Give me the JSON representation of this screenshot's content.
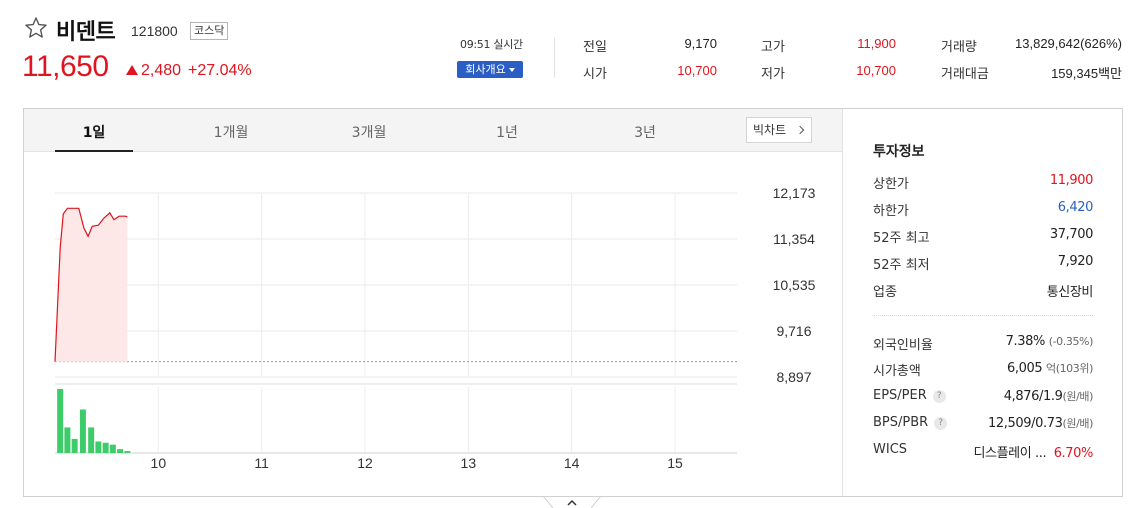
{
  "header": {
    "name": "비덴트",
    "code": "121800",
    "market": "코스닥",
    "price": "11,650",
    "change_abs": "2,480",
    "change_pct": "+27.04%",
    "realtime": "09:51 실시간",
    "company_btn": "회사개요"
  },
  "quote": {
    "prev_close": {
      "label": "전일",
      "value": "9,170"
    },
    "open": {
      "label": "시가",
      "value": "10,700"
    },
    "high": {
      "label": "고가",
      "value": "11,900"
    },
    "low": {
      "label": "저가",
      "value": "10,700"
    },
    "volume": {
      "label": "거래량",
      "value": "13,829,642(626%)"
    },
    "amount": {
      "label": "거래대금",
      "value": "159,345백만"
    }
  },
  "tabs": [
    "1일",
    "1개월",
    "3개월",
    "1년",
    "3년"
  ],
  "bigchart_label": "빅차트",
  "colors": {
    "up": "#e0141e",
    "down": "#2b5ec4",
    "volume_bar": "#3ecb6a",
    "area_fill": "#fde7e7"
  },
  "chart_data": {
    "type": "area",
    "price_axis": [
      "12,173",
      "11,354",
      "10,535",
      "9,716",
      "8,897"
    ],
    "price_ylim": [
      8897,
      12173
    ],
    "time_ticks": [
      "10",
      "11",
      "12",
      "13",
      "14",
      "15"
    ],
    "prev_close": 9170,
    "price_series": [
      {
        "t": 9.0,
        "v": 9170
      },
      {
        "t": 9.05,
        "v": 11200
      },
      {
        "t": 9.08,
        "v": 11800
      },
      {
        "t": 9.12,
        "v": 11900
      },
      {
        "t": 9.18,
        "v": 11900
      },
      {
        "t": 9.23,
        "v": 11900
      },
      {
        "t": 9.28,
        "v": 11550
      },
      {
        "t": 9.32,
        "v": 11400
      },
      {
        "t": 9.36,
        "v": 11580
      },
      {
        "t": 9.42,
        "v": 11600
      },
      {
        "t": 9.47,
        "v": 11720
      },
      {
        "t": 9.53,
        "v": 11820
      },
      {
        "t": 9.57,
        "v": 11700
      },
      {
        "t": 9.62,
        "v": 11760
      },
      {
        "t": 9.68,
        "v": 11760
      },
      {
        "t": 9.7,
        "v": 11750
      }
    ],
    "volume_series": [
      {
        "t": 9.05,
        "v": 1.0
      },
      {
        "t": 9.12,
        "v": 0.4
      },
      {
        "t": 9.19,
        "v": 0.22
      },
      {
        "t": 9.27,
        "v": 0.68
      },
      {
        "t": 9.35,
        "v": 0.4
      },
      {
        "t": 9.42,
        "v": 0.18
      },
      {
        "t": 9.49,
        "v": 0.16
      },
      {
        "t": 9.56,
        "v": 0.13
      },
      {
        "t": 9.63,
        "v": 0.06
      },
      {
        "t": 9.7,
        "v": 0.03
      }
    ]
  },
  "invest": {
    "title": "투자정보",
    "rows": [
      {
        "label": "상한가",
        "value": "11,900",
        "tone": "red"
      },
      {
        "label": "하한가",
        "value": "6,420",
        "tone": "blue"
      },
      {
        "label": "52주 최고",
        "value": "37,700",
        "tone": ""
      },
      {
        "label": "52주 최저",
        "value": "7,920",
        "tone": ""
      },
      {
        "label": "업종",
        "value": "통신장비",
        "tone": ""
      }
    ],
    "rows2": {
      "foreign": {
        "label": "외국인비율",
        "value": "7.38%",
        "sub": "(-0.35%)"
      },
      "mktcap": {
        "label": "시가총액",
        "value": "6,005",
        "sub": "억(103위)"
      },
      "eps": {
        "label": "EPS/PER",
        "value": "4,876/1.9",
        "sub": "(원/배)"
      },
      "bps": {
        "label": "BPS/PBR",
        "value": "12,509/0.73",
        "sub": "(원/배)"
      },
      "wics": {
        "label": "WICS",
        "value": "디스플레이 ...",
        "pct": "6.70%"
      }
    },
    "help_glyph": "?"
  }
}
